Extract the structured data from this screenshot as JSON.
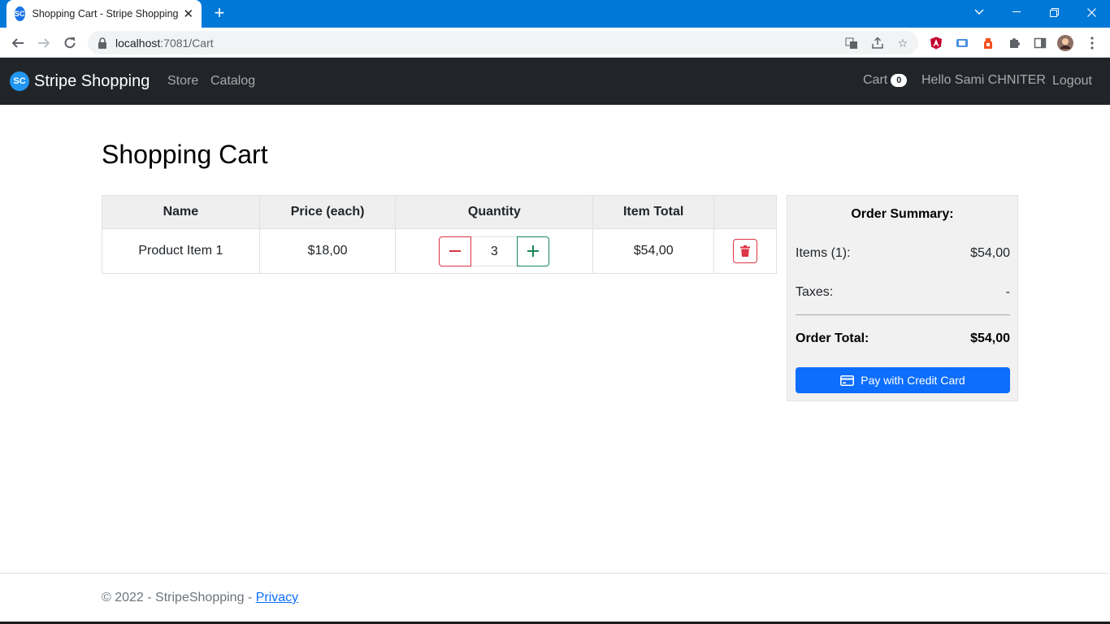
{
  "browser": {
    "tab_title": "Shopping Cart - Stripe Shopping",
    "favicon_text": "SC",
    "url_host": "localhost",
    "url_path": ":7081/Cart"
  },
  "navbar": {
    "brand_logo_text": "SC",
    "brand": "Stripe Shopping",
    "links": [
      "Store",
      "Catalog"
    ],
    "cart_label": "Cart",
    "cart_count": "0",
    "greeting": "Hello Sami CHNITER",
    "logout": "Logout"
  },
  "page": {
    "title": "Shopping Cart"
  },
  "cart_table": {
    "headers": [
      "Name",
      "Price (each)",
      "Quantity",
      "Item Total",
      ""
    ],
    "rows": [
      {
        "name": "Product Item 1",
        "price": "$18,00",
        "quantity": "3",
        "total": "$54,00"
      }
    ]
  },
  "summary": {
    "title": "Order Summary:",
    "items_label": "Items (1):",
    "items_value": "$54,00",
    "taxes_label": "Taxes:",
    "taxes_value": "-",
    "total_label": "Order Total:",
    "total_value": "$54,00",
    "pay_button": "Pay with Credit Card"
  },
  "footer": {
    "text": "© 2022 - StripeShopping - ",
    "privacy_link": "Privacy"
  },
  "colors": {
    "tab_strip": "#0078d7",
    "navbar": "#212529",
    "danger": "#dc3545",
    "success": "#198754",
    "primary": "#0d6efd"
  }
}
